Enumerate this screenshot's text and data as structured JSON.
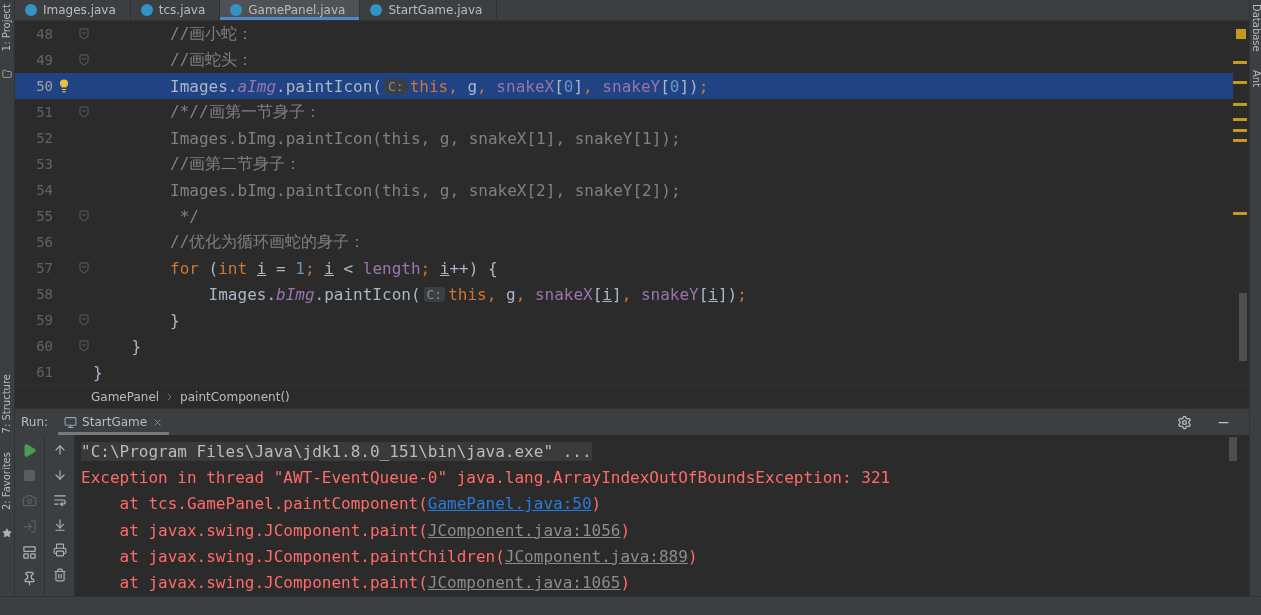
{
  "editor_tabs": [
    {
      "label": "Images.java",
      "selected": false
    },
    {
      "label": "tcs.java",
      "selected": false
    },
    {
      "label": "GamePanel.java",
      "selected": true
    },
    {
      "label": "StartGame.java",
      "selected": false
    }
  ],
  "left_sidebar": [
    {
      "label": "1: Project"
    },
    {
      "label": "7: Structure"
    },
    {
      "label": "2: Favorites"
    }
  ],
  "right_sidebar": [
    {
      "label": "Database"
    },
    {
      "label": "Ant"
    }
  ],
  "code_lines": [
    {
      "number": "48",
      "highlighted": false,
      "fold": true,
      "bulb": false,
      "tokens": [
        {
          "kind": "comment",
          "text": "        //画小蛇："
        }
      ]
    },
    {
      "number": "49",
      "highlighted": false,
      "fold": true,
      "bulb": false,
      "tokens": [
        {
          "kind": "comment",
          "text": "        //画蛇头："
        }
      ]
    },
    {
      "number": "50",
      "highlighted": true,
      "fold": false,
      "bulb": true,
      "tokens": [
        {
          "kind": "plain",
          "text": "        Images."
        },
        {
          "kind": "static",
          "text": "aImg"
        },
        {
          "kind": "plain",
          "text": ".paintIcon("
        },
        {
          "kind": "hint",
          "text": "C:"
        },
        {
          "kind": "keyword",
          "text": "this"
        },
        {
          "kind": "keyword",
          "text": ","
        },
        {
          "kind": "plain",
          "text": " g"
        },
        {
          "kind": "keyword",
          "text": ","
        },
        {
          "kind": "field",
          "text": " snakeX"
        },
        {
          "kind": "plain",
          "text": "["
        },
        {
          "kind": "number",
          "text": "0"
        },
        {
          "kind": "plain",
          "text": "]"
        },
        {
          "kind": "keyword",
          "text": ","
        },
        {
          "kind": "field",
          "text": " snakeY"
        },
        {
          "kind": "plain",
          "text": "["
        },
        {
          "kind": "number",
          "text": "0"
        },
        {
          "kind": "plain",
          "text": "])"
        },
        {
          "kind": "keyword",
          "text": ";"
        }
      ]
    },
    {
      "number": "51",
      "highlighted": false,
      "fold": true,
      "bulb": false,
      "tokens": [
        {
          "kind": "comment",
          "text": "        /*//画第一节身子："
        }
      ]
    },
    {
      "number": "52",
      "highlighted": false,
      "fold": false,
      "bulb": false,
      "tokens": [
        {
          "kind": "comment",
          "text": "        Images.bImg.paintIcon(this, g, snakeX[1], snakeY[1]);"
        }
      ]
    },
    {
      "number": "53",
      "highlighted": false,
      "fold": false,
      "bulb": false,
      "tokens": [
        {
          "kind": "comment",
          "text": "        //画第二节身子："
        }
      ]
    },
    {
      "number": "54",
      "highlighted": false,
      "fold": false,
      "bulb": false,
      "tokens": [
        {
          "kind": "comment",
          "text": "        Images.bImg.paintIcon(this, g, snakeX[2], snakeY[2]);"
        }
      ]
    },
    {
      "number": "55",
      "highlighted": false,
      "fold": true,
      "bulb": false,
      "tokens": [
        {
          "kind": "comment",
          "text": "         */"
        }
      ]
    },
    {
      "number": "56",
      "highlighted": false,
      "fold": false,
      "bulb": false,
      "tokens": [
        {
          "kind": "comment",
          "text": "        //优化为循环画蛇的身子："
        }
      ]
    },
    {
      "number": "57",
      "highlighted": false,
      "fold": true,
      "bulb": false,
      "tokens": [
        {
          "kind": "keyword",
          "text": "        for"
        },
        {
          "kind": "plain",
          "text": " ("
        },
        {
          "kind": "keyword",
          "text": "int "
        },
        {
          "kind": "var",
          "text": "i"
        },
        {
          "kind": "plain",
          "text": " = "
        },
        {
          "kind": "number",
          "text": "1"
        },
        {
          "kind": "keyword",
          "text": "; "
        },
        {
          "kind": "var",
          "text": "i"
        },
        {
          "kind": "plain",
          "text": " < "
        },
        {
          "kind": "field",
          "text": "length"
        },
        {
          "kind": "keyword",
          "text": "; "
        },
        {
          "kind": "var",
          "text": "i"
        },
        {
          "kind": "plain",
          "text": "++) {"
        }
      ]
    },
    {
      "number": "58",
      "highlighted": false,
      "fold": false,
      "bulb": false,
      "tokens": [
        {
          "kind": "plain",
          "text": "            Images."
        },
        {
          "kind": "static",
          "text": "bImg"
        },
        {
          "kind": "plain",
          "text": ".paintIcon("
        },
        {
          "kind": "hint",
          "text": "C:"
        },
        {
          "kind": "keyword",
          "text": "this"
        },
        {
          "kind": "keyword",
          "text": ","
        },
        {
          "kind": "plain",
          "text": " g"
        },
        {
          "kind": "keyword",
          "text": ","
        },
        {
          "kind": "field",
          "text": " snakeX"
        },
        {
          "kind": "plain",
          "text": "["
        },
        {
          "kind": "var",
          "text": "i"
        },
        {
          "kind": "plain",
          "text": "]"
        },
        {
          "kind": "keyword",
          "text": ","
        },
        {
          "kind": "field",
          "text": " snakeY"
        },
        {
          "kind": "plain",
          "text": "["
        },
        {
          "kind": "var",
          "text": "i"
        },
        {
          "kind": "plain",
          "text": "])"
        },
        {
          "kind": "keyword",
          "text": ";"
        }
      ]
    },
    {
      "number": "59",
      "highlighted": false,
      "fold": true,
      "bulb": false,
      "tokens": [
        {
          "kind": "plain",
          "text": "        }"
        }
      ]
    },
    {
      "number": "60",
      "highlighted": false,
      "fold": true,
      "bulb": false,
      "tokens": [
        {
          "kind": "plain",
          "text": "    }"
        }
      ]
    },
    {
      "number": "61",
      "highlighted": false,
      "fold": false,
      "bulb": false,
      "tokens": [
        {
          "kind": "plain",
          "text": "}"
        }
      ]
    }
  ],
  "breadcrumb": [
    "GamePanel",
    "paintComponent()"
  ],
  "run_panel": {
    "label": "Run:",
    "tab": {
      "label": "StartGame",
      "selected": true
    },
    "console": [
      {
        "kind": "command",
        "text": "\"C:\\Program Files\\Java\\jdk1.8.0_151\\bin\\java.exe\" ..."
      },
      {
        "kind": "error",
        "text": "Exception in thread \"AWT-EventQueue-0\" java.lang.ArrayIndexOutOfBoundsException: 321"
      },
      {
        "kind": "trace",
        "prefix": "    at tcs.GamePanel.paintComponent(",
        "link": "GamePanel.java:50",
        "link_highlighted": true,
        "suffix": ")"
      },
      {
        "kind": "trace",
        "prefix": "    at javax.swing.JComponent.paint(",
        "link": "JComponent.java:1056",
        "link_highlighted": false,
        "suffix": ")"
      },
      {
        "kind": "trace",
        "prefix": "    at javax.swing.JComponent.paintChildren(",
        "link": "JComponent.java:889",
        "link_highlighted": false,
        "suffix": ")"
      },
      {
        "kind": "trace",
        "prefix": "    at javax.swing.JComponent.paint(",
        "link": "JComponent.java:1065",
        "link_highlighted": false,
        "suffix": ")"
      }
    ]
  }
}
